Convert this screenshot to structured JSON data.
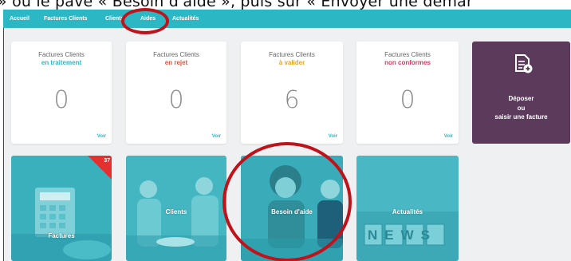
{
  "caption": "» ou le pavé « Besoin d'aide », puis sur « Envoyer une demar",
  "nav": {
    "items": [
      {
        "label": "Accueil"
      },
      {
        "label": "Factures Clients"
      },
      {
        "label": "Clients"
      },
      {
        "label": "Aides"
      },
      {
        "label": "Actualités"
      }
    ]
  },
  "cards": [
    {
      "line1": "Factures Clients",
      "line2": "en traitement",
      "count": "0",
      "voir": "Voir",
      "accent": "#2cb7c4"
    },
    {
      "line1": "Factures Clients",
      "line2": "en rejet",
      "count": "0",
      "voir": "Voir",
      "accent": "#e0533d"
    },
    {
      "line1": "Factures Clients",
      "line2": "à valider",
      "count": "6",
      "voir": "Voir",
      "accent": "#f0a21a"
    },
    {
      "line1": "Factures Clients",
      "line2": "non conformes",
      "count": "0",
      "voir": "Voir",
      "accent": "#d9395f"
    }
  ],
  "deposit": {
    "line1": "Déposer",
    "line2": "ou",
    "line3": "saisir une facture",
    "icon": "document-add-icon"
  },
  "tiles": [
    {
      "label": "Factures",
      "badge": "37"
    },
    {
      "label": "Clients"
    },
    {
      "label": "Besoin d'aide"
    },
    {
      "label": "Actualités",
      "image_text": "NEWS"
    }
  ],
  "colors": {
    "nav": "#2cb7c4",
    "tile_tint": "#2cb7c4",
    "deposit": "#5b3a5c",
    "highlight": "#c0121b",
    "badge": "#e2312f"
  }
}
